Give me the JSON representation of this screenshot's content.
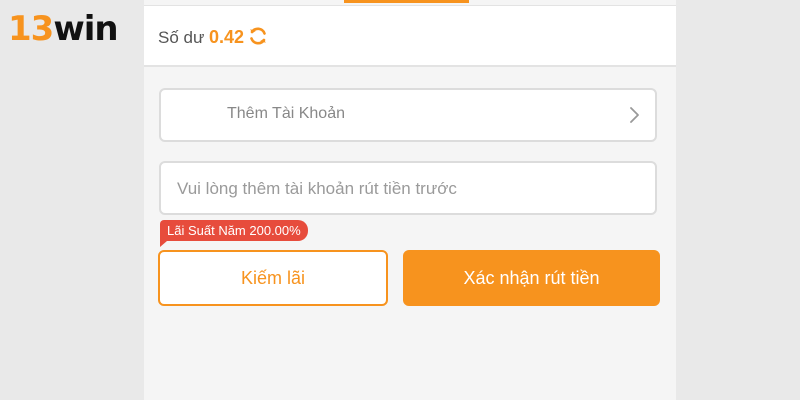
{
  "logo": {
    "number": "13",
    "word": "win"
  },
  "balance": {
    "label": "Số dư",
    "value": "0.42"
  },
  "add_account": {
    "label": "Thêm Tài Khoản"
  },
  "withdraw_field": {
    "placeholder": "Vui lòng thêm tài khoản rút tiền trước",
    "value": ""
  },
  "rate_badge": {
    "text": "Lãi Suất Năm 200.00%"
  },
  "buttons": {
    "earn": "Kiếm lãi",
    "confirm": "Xác nhận rút tiền"
  },
  "icons": {
    "refresh": "refresh-icon",
    "chevron": "chevron-right-icon"
  },
  "colors": {
    "accent": "#f7931e",
    "badge": "#e74c3c"
  }
}
